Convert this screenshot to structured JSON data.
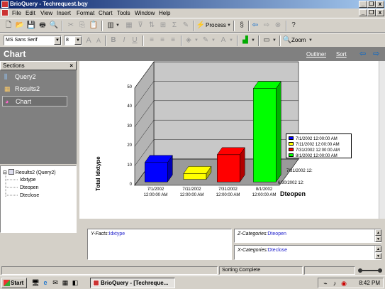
{
  "window": {
    "title": "BrioQuery - Techrequest.bqy",
    "minimize_glyph": "_",
    "restore_glyph": "❐",
    "close_glyph": "x"
  },
  "menu": [
    "File",
    "Edit",
    "View",
    "Insert",
    "Format",
    "Chart",
    "Tools",
    "Window",
    "Help"
  ],
  "toolbar": {
    "process_label": "Process",
    "zoom_label": "Zoom",
    "font_name": "MS Sans Serif",
    "font_size": "8"
  },
  "section_header": {
    "title": "Chart",
    "outliner_link": "Outliner",
    "sort_link": "Sort",
    "back_glyph": "⇦",
    "forward_glyph": "⇨"
  },
  "sections_panel": {
    "title": "Sections",
    "close_glyph": "×",
    "items": [
      {
        "label": "Query2",
        "icon": "query-icon",
        "glyph": "⫼"
      },
      {
        "label": "Results2",
        "icon": "results-icon",
        "glyph": "▦"
      },
      {
        "label": "Chart",
        "icon": "chart-icon",
        "glyph": "◕"
      }
    ]
  },
  "tree": {
    "root": "Results2 (Query2)",
    "children": [
      "Idxtype",
      "Dteopen",
      "Dteclose"
    ]
  },
  "chart_data": {
    "type": "bar",
    "title": "Chart",
    "ylabel": "Total Idxtype",
    "xlabel": "Dteopen",
    "ylim": [
      0,
      50
    ],
    "yticks": [
      "0",
      "10",
      "20",
      "30",
      "40",
      "50"
    ],
    "categories": [
      "7/1/2002\n12:00:00 AM",
      "7/11/2002\n12:00:00 AM",
      "7/31/2002\n12:00:00 AM",
      "8/1/2002\n12:00:00 AM"
    ],
    "z_categories": [
      "7/31/2002 12:",
      "6/30/2002 12:"
    ],
    "values": [
      10,
      3,
      14,
      48
    ],
    "colors": [
      "#0000ff",
      "#ffff00",
      "#ff0000",
      "#00ff00"
    ],
    "legend": [
      "7/1/2002 12:00:00 AM",
      "7/11/2002 12:00:00 AM",
      "7/31/2002 12:00:00 AM",
      "8/1/2002 12:00:00 AM"
    ],
    "legend_position": "right"
  },
  "facts_pane": {
    "y_facts_label": "Y-Facts:",
    "y_facts_value": "Idxtype",
    "z_categories_label": "Z-Categories:",
    "z_categories_value": "Dteopen",
    "x_categories_label": "X-Categories:",
    "x_categories_value": "Dteclose"
  },
  "status": {
    "message": "Sorting Complete"
  },
  "taskbar": {
    "start_label": "Start",
    "task_label": "BrioQuery - [Techreque...",
    "clock": "8:42 PM"
  }
}
